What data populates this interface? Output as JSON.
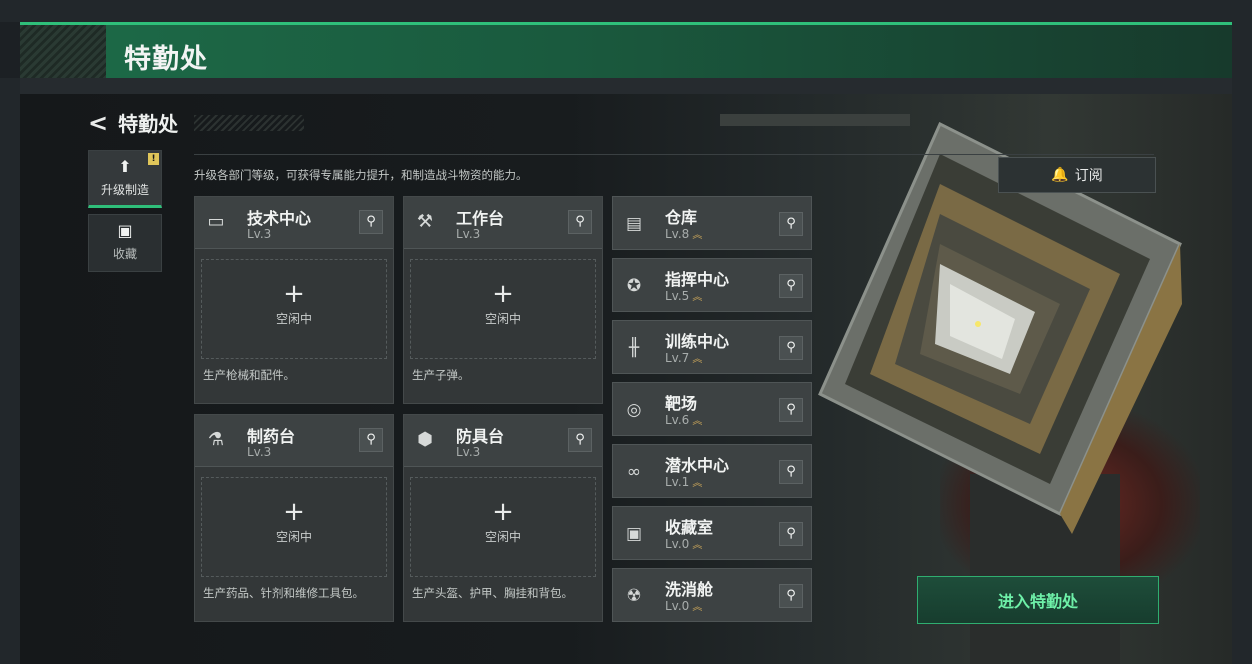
{
  "header": {
    "title": "特勤处"
  },
  "nav": {
    "back_label": "特勤处"
  },
  "side_tabs": [
    {
      "label": "升级制造",
      "icon": "upgrade-icon",
      "badge": "!"
    },
    {
      "label": "收藏",
      "icon": "collection-icon"
    }
  ],
  "description": "升级各部门等级，可获得专属能力提升，和制造战斗物资的能力。",
  "subscribe": {
    "label": "订阅",
    "icon": "bell-icon"
  },
  "workstations": [
    {
      "name": "技术中心",
      "level": "Lv.3",
      "icon": "monitor-icon",
      "status": "空闲中",
      "desc": "生产枪械和配件。"
    },
    {
      "name": "工作台",
      "level": "Lv.3",
      "icon": "tools-icon",
      "status": "空闲中",
      "desc": "生产子弹。"
    },
    {
      "name": "制药台",
      "level": "Lv.3",
      "icon": "microscope-icon",
      "status": "空闲中",
      "desc": "生产药品、针剂和维修工具包。"
    },
    {
      "name": "防具台",
      "level": "Lv.3",
      "icon": "armor-icon",
      "status": "空闲中",
      "desc": "生产头盔、护甲、胸挂和背包。"
    }
  ],
  "facilities": [
    {
      "name": "仓库",
      "level": "Lv.8",
      "icon": "warehouse-icon"
    },
    {
      "name": "指挥中心",
      "level": "Lv.5",
      "icon": "command-icon"
    },
    {
      "name": "训练中心",
      "level": "Lv.7",
      "icon": "dumbbell-icon"
    },
    {
      "name": "靶场",
      "level": "Lv.6",
      "icon": "target-icon"
    },
    {
      "name": "潜水中心",
      "level": "Lv.1",
      "icon": "goggles-icon"
    },
    {
      "name": "收藏室",
      "level": "Lv.0",
      "icon": "display-case-icon"
    },
    {
      "name": "洗消舱",
      "level": "Lv.0",
      "icon": "radiation-icon"
    }
  ],
  "enter_button": {
    "label": "进入特勤处"
  }
}
